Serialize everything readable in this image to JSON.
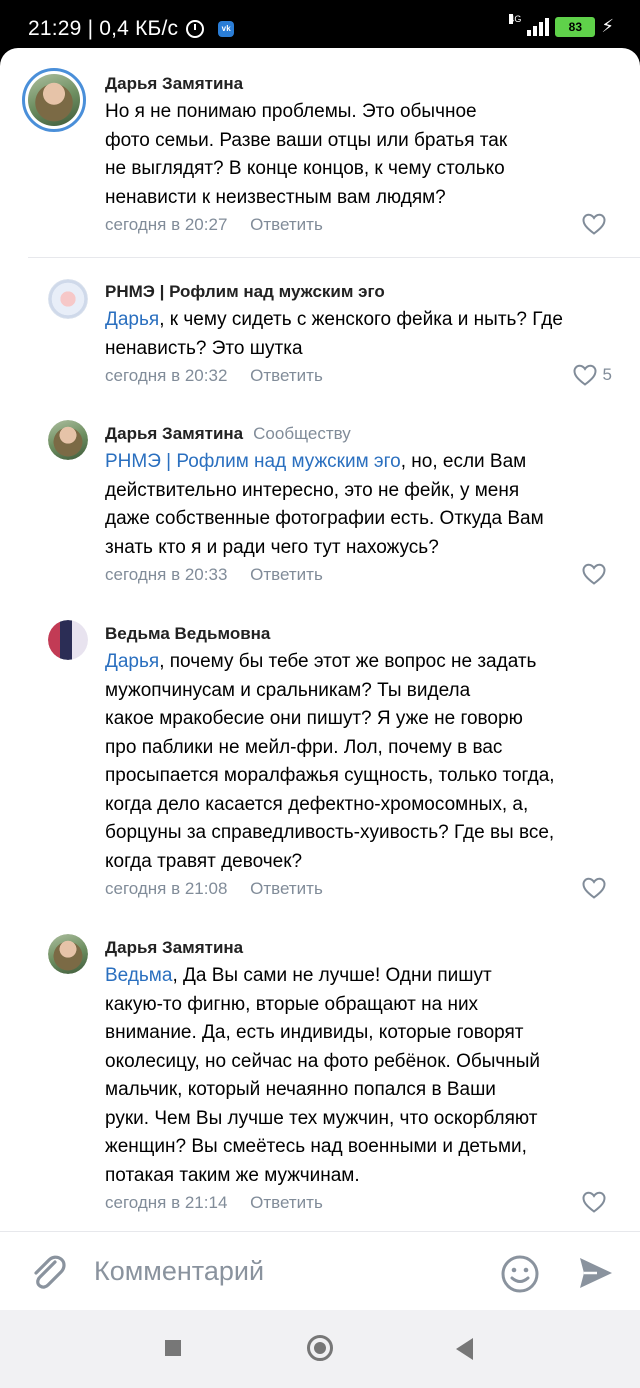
{
  "status": {
    "time": "21:29",
    "speed": "| 0,4 КБ/с",
    "network": "4G",
    "battery": "83"
  },
  "comments": [
    {
      "author": "Дарья Замятина",
      "tag": "",
      "mention": "",
      "text": "Но я не понимаю проблемы. Это обычное фото семьи. Разве ваши отцы или братья так не выглядят? В конце концов, к чему столько ненависти к неизвестным вам людям?",
      "lines": [
        "Но я не понимаю проблемы. Это обычное",
        "фото семьи. Разве ваши отцы или братья так",
        "не выглядят? В конце концов, к чему столько",
        "ненависти к неизвестным вам людям?"
      ],
      "time": "сегодня в 20:27",
      "reply": "Ответить",
      "likes": ""
    },
    {
      "author": "РНМЭ | Рофлим над мужским эго",
      "tag": "",
      "mention": "Дарья",
      "lines": [
        ", к чему сидеть с женского фейка и ныть? Где",
        "ненависть? Это шутка"
      ],
      "time": "сегодня в 20:32",
      "reply": "Ответить",
      "likes": "5"
    },
    {
      "author": "Дарья Замятина",
      "tag": "Сообществу",
      "mention": "РНМЭ | Рофлим над мужским эго",
      "lines": [
        ", но, если Вам",
        "действительно интересно, это не фейк, у меня",
        "даже собственные фотографии есть. Откуда Вам",
        "знать кто я и ради чего тут нахожусь?"
      ],
      "time": "сегодня в 20:33",
      "reply": "Ответить",
      "likes": ""
    },
    {
      "author": "Ведьма Ведьмовна",
      "tag": "",
      "mention": "Дарья",
      "lines": [
        ", почему бы тебе этот же вопрос не задать",
        "мужопчинусам и сральникам? Ты видела",
        "какое мракобесие они пишут? Я уже не говорю",
        "про паблики не мейл-фри. Лол, почему в вас",
        "просыпается моралфажья сущность, только тогда,",
        "когда дело касается дефектно-хромосомных, а,",
        "борцуны за справедливость-хуивость? Где вы все,",
        "когда травят девочек?"
      ],
      "time": "сегодня в 21:08",
      "reply": "Ответить",
      "likes": ""
    },
    {
      "author": "Дарья Замятина",
      "tag": "",
      "mention": "Ведьма",
      "lines": [
        ", Да Вы сами не лучше! Одни пишут",
        "какую-то фигню, вторые обращают на них",
        "внимание. Да, есть индивиды, которые говорят",
        "околесицу, но сейчас на фото ребёнок. Обычный",
        "мальчик, который нечаянно попался в Ваши",
        "руки. Чем Вы лучше тех мужчин, что оскорбляют",
        "женщин? Вы смеётесь над военными и детьми,",
        "потакая таким же мужчинам."
      ],
      "time": "сегодня в 21:14",
      "reply": "Ответить",
      "likes": ""
    }
  ],
  "composer": {
    "placeholder": "Комментарий"
  },
  "icons": {
    "attach": "paperclip-icon",
    "emoji": "smile-icon",
    "send": "send-icon",
    "like": "heart-icon"
  },
  "colors": {
    "mention": "#2a6fbf",
    "meta": "#818c99",
    "avatar_ring": "#4a8fd9"
  }
}
